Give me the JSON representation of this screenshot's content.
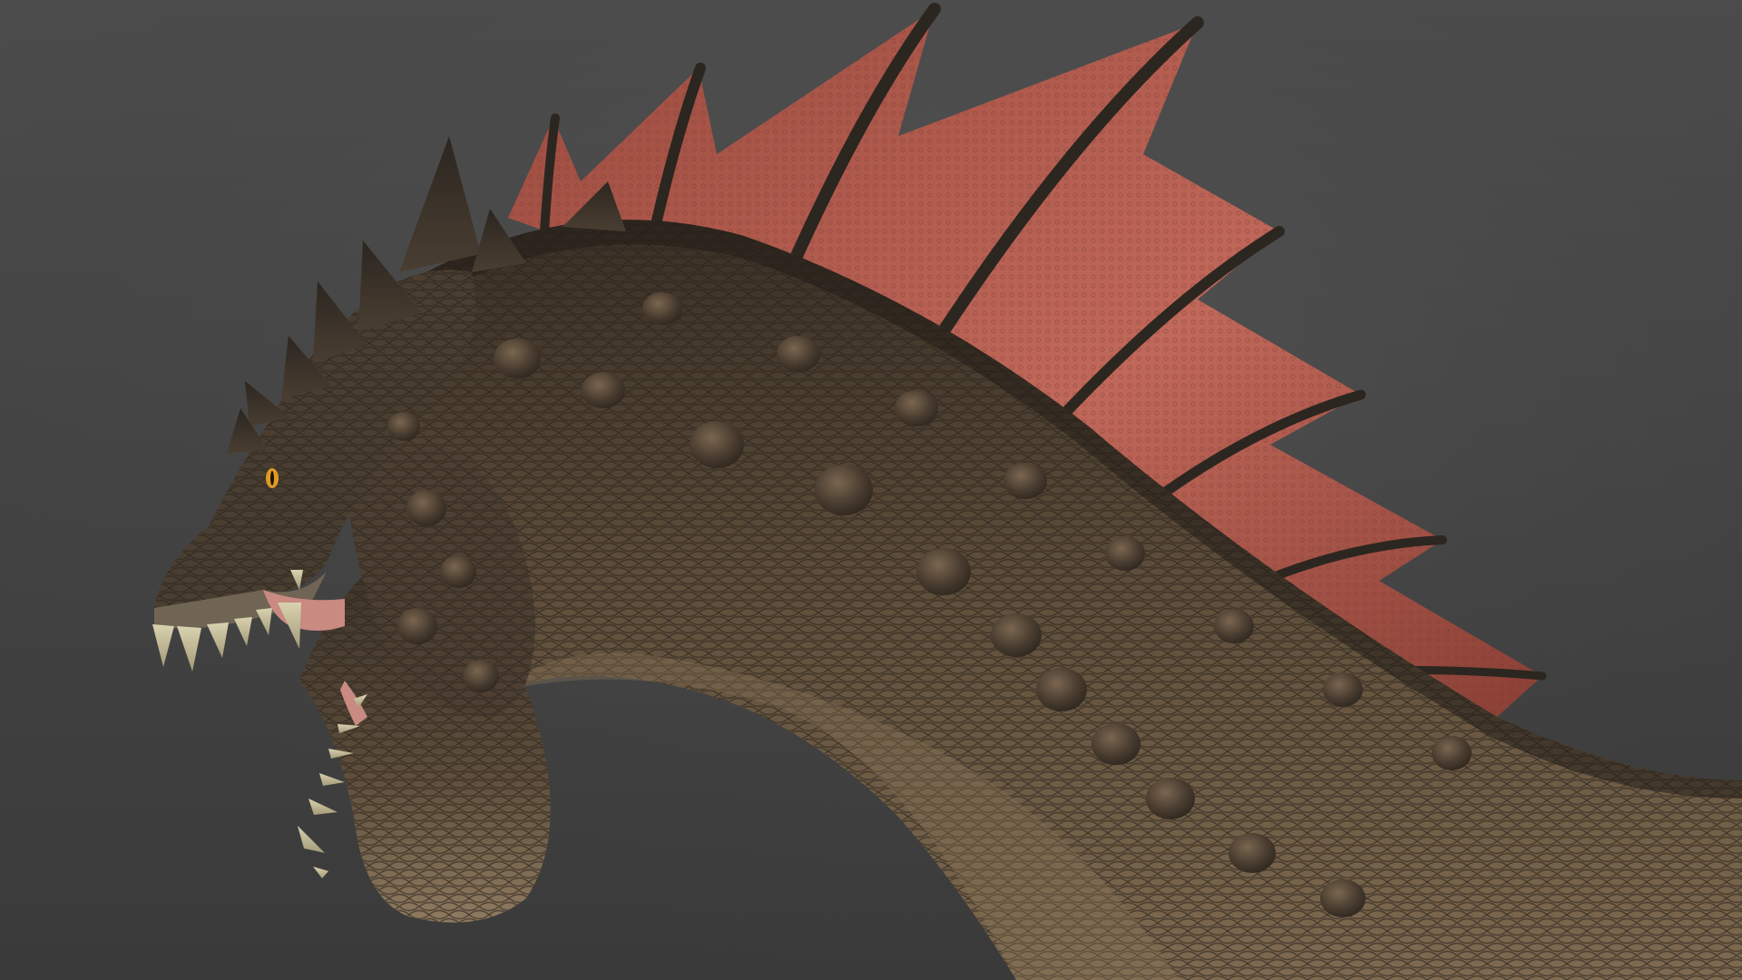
{
  "scene": {
    "subject": "dragon-head-and-neck",
    "colors": {
      "background_top": "#4d4d4d",
      "background_bottom": "#3a3a3a",
      "scale_dark": "#3a3026",
      "scale_mid": "#5c4c39",
      "scale_light": "#7e6a50",
      "throat_light": "#8f7b60",
      "fin_red": "#9b4a3e",
      "fin_pink": "#c0685a",
      "fin_dark": "#5a2c25",
      "spine_dark": "#2c2620",
      "tooth": "#d9d2b0",
      "gum": "#c98a82",
      "eye": "#e09a24"
    }
  }
}
